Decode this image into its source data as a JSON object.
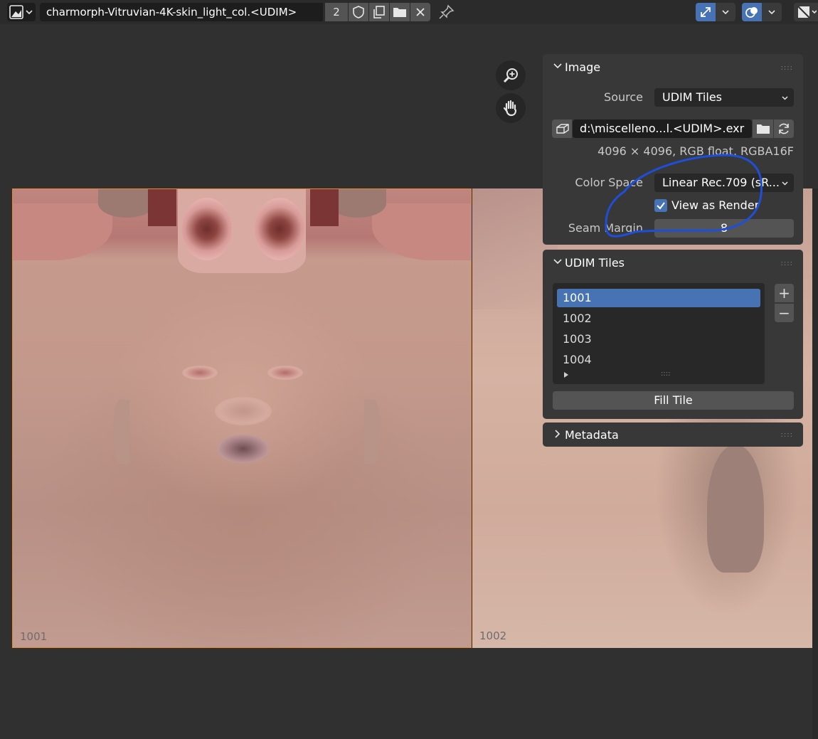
{
  "header": {
    "image_name": "charmorph-Vitruvian-4K-skin_light_col.<UDIM>",
    "users_count": "2",
    "icons": [
      "image-editor-type-icon",
      "chevron-down-icon",
      "fake-user-shield-icon",
      "duplicate-icon",
      "open-folder-icon",
      "unlink-x-icon",
      "pin-icon",
      "gizmo-toggle-icon",
      "overlay-toggle-icon",
      "display-channels-icon"
    ]
  },
  "canvas": {
    "tiles": [
      {
        "label": "1001"
      },
      {
        "label": "1002"
      }
    ],
    "gizmos": [
      "zoom-icon",
      "pan-hand-icon"
    ]
  },
  "sidebar": {
    "image_panel": {
      "title": "Image",
      "source_label": "Source",
      "source_value": "UDIM Tiles",
      "filepath": "d:\\miscelleno...l.<UDIM>.exr",
      "info": "4096 × 4096,  RGB float, RGBA16F",
      "color_space_label": "Color Space",
      "color_space_value": "Linear Rec.709 (sR...",
      "view_as_render_label": "View as Render",
      "view_as_render": true,
      "seam_margin_label": "Seam Margin",
      "seam_margin_value": "8"
    },
    "udim_panel": {
      "title": "UDIM Tiles",
      "tiles": [
        "1001",
        "1002",
        "1003",
        "1004"
      ],
      "selected": "1001",
      "add_label": "+",
      "remove_label": "−",
      "fill_tile_label": "Fill Tile"
    },
    "metadata_panel": {
      "title": "Metadata"
    }
  },
  "colors": {
    "accent": "#4772b3",
    "active_tile_border": "#e38a3a",
    "annotation": "#1e4fd8"
  }
}
